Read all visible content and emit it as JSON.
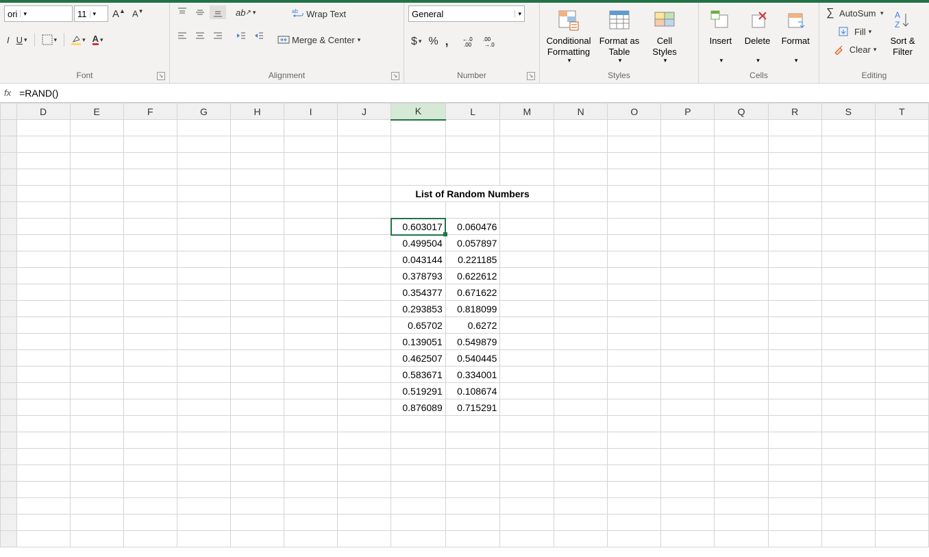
{
  "font": {
    "name": "ori",
    "size": "11"
  },
  "format": {
    "numberFormat": "General"
  },
  "ribbon": {
    "wrapText": "Wrap Text",
    "mergeCenter": "Merge & Center",
    "conditional": "Conditional Formatting",
    "formatAs": "Format as Table",
    "cellStyles": "Cell Styles",
    "insert": "Insert",
    "delete": "Delete",
    "formatBtn": "Format",
    "autosum": "AutoSum",
    "fill": "Fill",
    "clear": "Clear",
    "sort": "Sort & Filter"
  },
  "groupLabels": {
    "font": "Font",
    "alignment": "Alignment",
    "number": "Number",
    "styles": "Styles",
    "cells": "Cells",
    "editing": "Editing"
  },
  "formula": "=RAND()",
  "columns": [
    "D",
    "E",
    "F",
    "G",
    "H",
    "I",
    "J",
    "K",
    "L",
    "M",
    "N",
    "O",
    "P",
    "Q",
    "R",
    "S",
    "T"
  ],
  "rowCount": 26,
  "selected": {
    "col": "K",
    "row": 7
  },
  "header": {
    "text": "List of Random Numbers",
    "col": "K",
    "row": 5
  },
  "dataStartRow": 7,
  "dataCols": [
    "K",
    "L"
  ],
  "dataK": [
    "0.603017",
    "0.499504",
    "0.043144",
    "0.378793",
    "0.354377",
    "0.293853",
    "0.65702",
    "0.139051",
    "0.462507",
    "0.583671",
    "0.519291",
    "0.876089"
  ],
  "dataL": [
    "0.060476",
    "0.057897",
    "0.221185",
    "0.622612",
    "0.671622",
    "0.818099",
    "0.6272",
    "0.549879",
    "0.540445",
    "0.334001",
    "0.108674",
    "0.715291"
  ]
}
